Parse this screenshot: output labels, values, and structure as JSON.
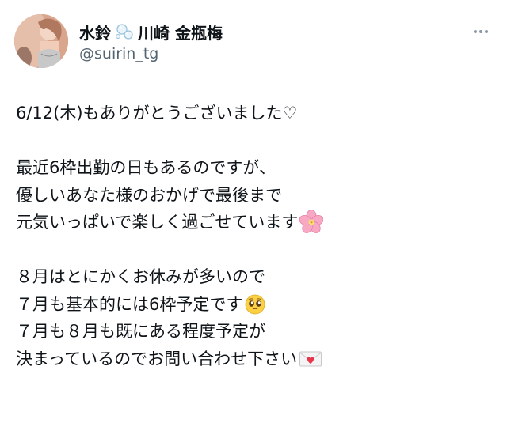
{
  "author": {
    "display_name_part1": "水鈴",
    "display_name_part2": "川崎 金瓶梅",
    "handle": "@suirin_tg"
  },
  "icons": {
    "avatar": "profile-photo",
    "name_emoji": "bubbles-icon",
    "more": "more-options-icon"
  },
  "post": {
    "line1": "6/12(木)もありがとうございました♡",
    "line2": "最近6枠出勤の日もあるのですが、",
    "line3": "優しいあなた様のおかげで最後まで",
    "line4": "元気いっぱいで楽しく過ごせています",
    "line5": "８月はとにかくお休みが多いので",
    "line6": "７月も基本的には6枠予定です",
    "line7": "７月も８月も既にある程度予定が",
    "line8": "決まっているのでお問い合わせ下さい"
  },
  "emojis": {
    "line4": "cherry-blossom-emoji",
    "line6": "pleading-face-emoji",
    "line8": "love-letter-emoji"
  },
  "colors": {
    "text": "#0f1419",
    "secondary": "#536471",
    "background": "#ffffff"
  }
}
